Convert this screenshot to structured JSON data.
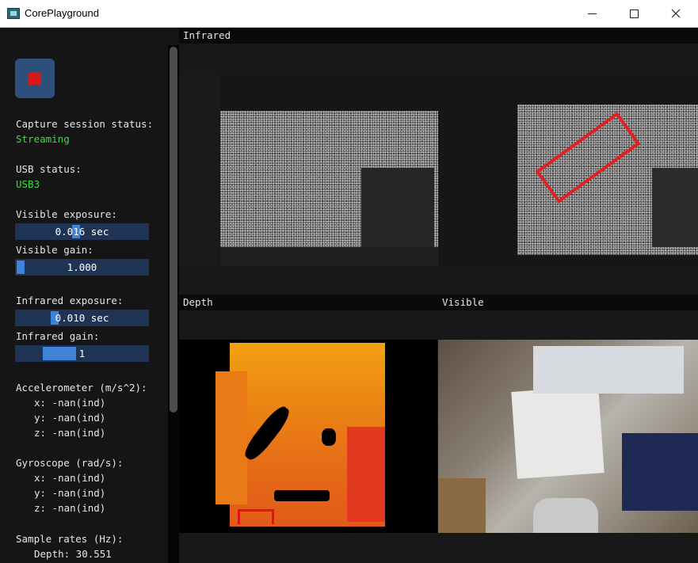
{
  "window": {
    "title": "CorePlayground"
  },
  "sidebar": {
    "capture_status_label": "Capture session status:",
    "capture_status_value": "Streaming",
    "usb_status_label": "USB status:",
    "usb_status_value": "USB3",
    "visible_exposure": {
      "label": "Visible exposure:",
      "value": "0.016 sec",
      "level": 0.45
    },
    "visible_gain": {
      "label": "Visible gain:",
      "value": "1.000",
      "level": 0.0
    },
    "infrared_exposure": {
      "label": "Infrared exposure:",
      "value": "0.010 sec",
      "level": 0.28
    },
    "infrared_gain": {
      "label": "Infrared gain:",
      "value": "1",
      "level": 0.27
    },
    "accelerometer": {
      "label": "Accelerometer (m/s^2):",
      "x": "x: -nan(ind)",
      "y": "y: -nan(ind)",
      "z": "z: -nan(ind)"
    },
    "gyroscope": {
      "label": "Gyroscope (rad/s):",
      "x": "x: -nan(ind)",
      "y": "y: -nan(ind)",
      "z": "z: -nan(ind)"
    },
    "sample_rates": {
      "label": "Sample rates (Hz):",
      "depth": "Depth: 30.551"
    }
  },
  "panes": {
    "infrared_title": "Infrared",
    "depth_title": "Depth",
    "visible_title": "Visible"
  },
  "colors": {
    "status_green": "#3ddc3d",
    "slider_bg": "#1f3454",
    "slider_grab": "#3f82d6",
    "stop_red": "#d8171b",
    "highlight_red": "#e32020"
  }
}
